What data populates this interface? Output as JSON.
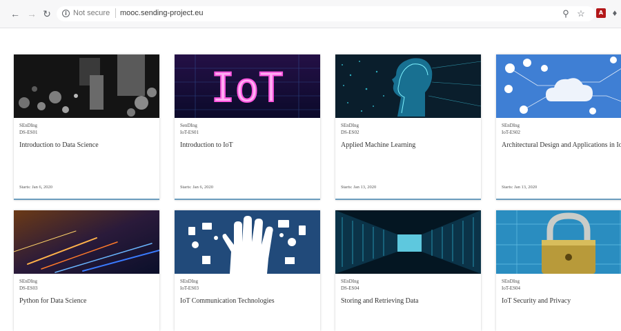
{
  "browser": {
    "security_label": "Not secure",
    "url": "mooc.sending-project.eu",
    "icons": [
      "back-arrow-icon",
      "forward-arrow-icon",
      "reload-icon",
      "info-icon",
      "zoom-icon",
      "star-icon",
      "pdf-extension-icon",
      "puzzle-extension-icon"
    ]
  },
  "courses": [
    {
      "org": "SEnDIng",
      "code": "DS-ES01",
      "title": "Introduction to Data Science",
      "starts": "Starts: Jan 6, 2020",
      "image": "blurred-city-lights"
    },
    {
      "org": "SenDIng",
      "code": "IoT-ES01",
      "title": "Introduction to IoT",
      "starts": "Starts: Jan 6, 2020",
      "image": "iot-neon-sign",
      "image_text": "IoT"
    },
    {
      "org": "SEnDIng",
      "code": "DS-ES02",
      "title": "Applied Machine Learning",
      "starts": "Starts: Jan 13, 2020",
      "image": "digital-head-profile"
    },
    {
      "org": "SEnDIng",
      "code": "IoT-ES02",
      "title": "Architectural Design and Applications in Io",
      "starts": "Starts: Jan 13, 2020",
      "image": "cloud-network-icons"
    },
    {
      "org": "SEnDIng",
      "code": "DS-ES03",
      "title": "Python for Data Science",
      "image": "light-streaks"
    },
    {
      "org": "SEnDIng",
      "code": "IoT-ES03",
      "title": "IoT Communication Technologies",
      "image": "hand-with-device-icons"
    },
    {
      "org": "SEnDIng",
      "code": "DS-ES04",
      "title": "Storing and Retrieving Data",
      "image": "data-center-corridor"
    },
    {
      "org": "SEnDIng",
      "code": "IoT-ES04",
      "title": "IoT Security and Privacy",
      "image": "padlock-on-circuit"
    }
  ]
}
